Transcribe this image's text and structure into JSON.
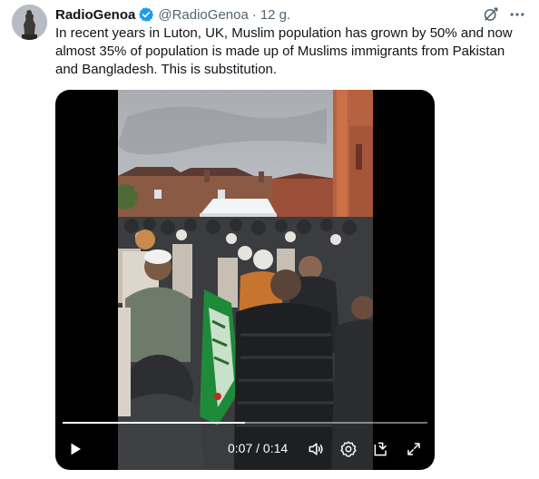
{
  "tweet": {
    "author_name": "RadioGenoa",
    "author_handle": "@RadioGenoa",
    "separator": "·",
    "timestamp": "12 g.",
    "verified_icon": "verified-badge-icon",
    "grok_icon": "grok-icon",
    "more_icon": "more-options-icon",
    "text": "In recent years in Luton, UK, Muslim population has grown by 50% and now almost 35% of population is made up of Muslims immigrants from Pakistan and Bangladesh. This is substitution.",
    "accent_color": "#1d9bf0"
  },
  "video": {
    "current_time": "0:07",
    "time_separator": " / ",
    "duration": "0:14",
    "progress": 0.5,
    "controls": {
      "play_icon": "play-icon",
      "volume_icon": "volume-icon",
      "settings_icon": "settings-gear-icon",
      "popout_icon": "pop-out-icon",
      "fullscreen_icon": "fullscreen-icon"
    }
  }
}
